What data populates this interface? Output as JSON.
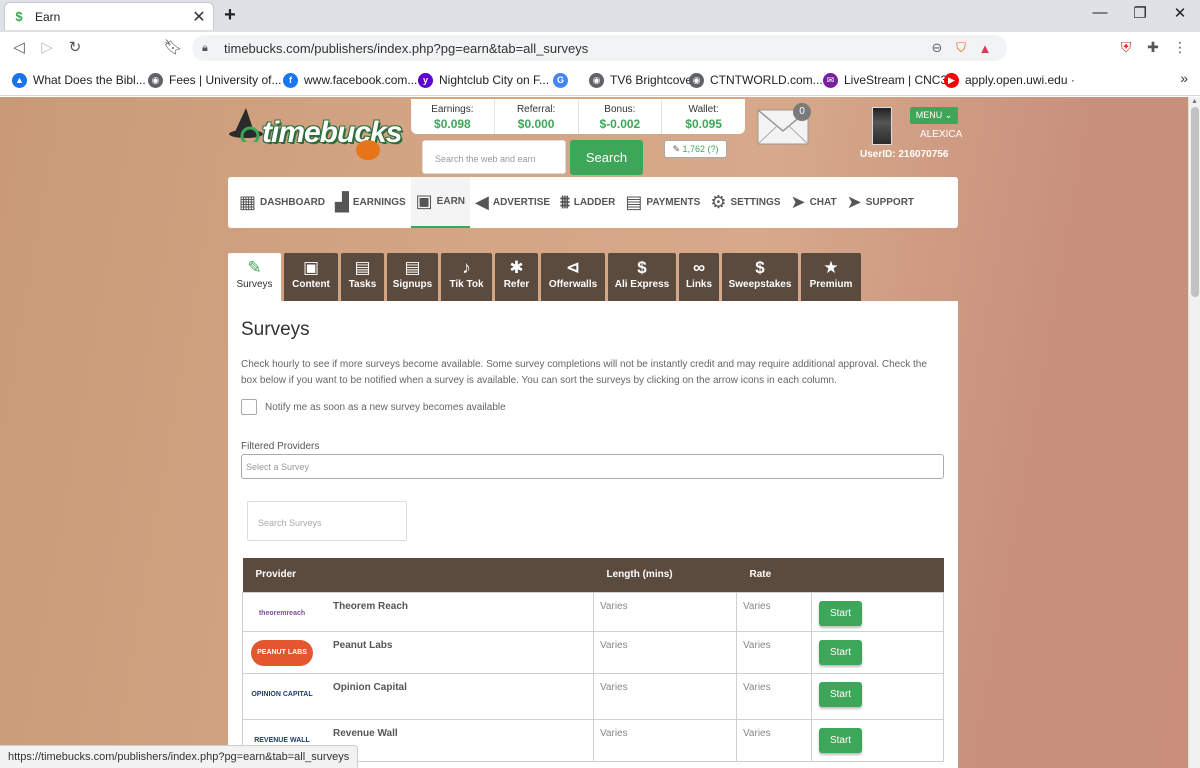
{
  "browser": {
    "tab_title": "Earn",
    "url": "timebucks.com/publishers/index.php?pg=earn&tab=all_surveys",
    "bookmarks": [
      {
        "label": "What Does the Bibl...",
        "color": "#1a73e8",
        "icon": "drive-icon"
      },
      {
        "label": "Fees | University of...",
        "color": "#5f6368",
        "icon": "globe-icon"
      },
      {
        "label": "www.facebook.com...",
        "color": "#1877f2",
        "icon": "facebook-icon"
      },
      {
        "label": "Nightclub City on F...",
        "color": "#6001d2",
        "icon": "yahoo-icon"
      },
      {
        "label": "",
        "color": "#4285f4",
        "icon": "google-icon"
      },
      {
        "label": "TV6 Brightcove",
        "color": "#5f6368",
        "icon": "globe-icon"
      },
      {
        "label": "CTNTWORLD.com...",
        "color": "#5f6368",
        "icon": "globe-icon"
      },
      {
        "label": "LiveStream | CNC3",
        "color": "#7b1fa2",
        "icon": "mail-icon"
      },
      {
        "label": "apply.open.uwi.edu ·",
        "color": "#ff0000",
        "icon": "youtube-icon"
      }
    ],
    "status_url": "https://timebucks.com/publishers/index.php?pg=earn&tab=all_surveys"
  },
  "header": {
    "logo_text": "timebucks",
    "stats": [
      {
        "label": "Earnings:",
        "value": "$0.098"
      },
      {
        "label": "Referral:",
        "value": "$0.000"
      },
      {
        "label": "Bonus:",
        "value": "$-0.002"
      },
      {
        "label": "Wallet:",
        "value": "$0.095"
      }
    ],
    "search_placeholder": "Search the web and earn",
    "search_button": "Search",
    "points": "1,762 (?)",
    "mail_count": "0",
    "menu_label": "MENU",
    "username": "ALEXICA",
    "userid": "UserID: 216070756"
  },
  "mainnav": [
    {
      "label": "Dashboard",
      "icon": "▦"
    },
    {
      "label": "Earnings",
      "icon": "▟"
    },
    {
      "label": "Earn",
      "icon": "▣",
      "active": true
    },
    {
      "label": "Advertise",
      "icon": "◀"
    },
    {
      "label": "Ladder",
      "icon": "⩩"
    },
    {
      "label": "Payments",
      "icon": "▤"
    },
    {
      "label": "Settings",
      "icon": "⚙"
    },
    {
      "label": "Chat",
      "icon": "➤"
    },
    {
      "label": "Support",
      "icon": "➤"
    }
  ],
  "subtabs": [
    {
      "label": "Surveys",
      "icon": "✎",
      "active": true,
      "width": 53
    },
    {
      "label": "Content",
      "icon": "▣",
      "width": 54
    },
    {
      "label": "Tasks",
      "icon": "▤",
      "width": 43
    },
    {
      "label": "Signups",
      "icon": "▤",
      "width": 51
    },
    {
      "label": "Tik Tok",
      "icon": "♪",
      "width": 51
    },
    {
      "label": "Refer",
      "icon": "✱",
      "width": 43
    },
    {
      "label": "Offerwalls",
      "icon": "⊲",
      "width": 64
    },
    {
      "label": "Ali Express",
      "icon": "$",
      "width": 68
    },
    {
      "label": "Links",
      "icon": "∞",
      "width": 40
    },
    {
      "label": "Sweepstakes",
      "icon": "$",
      "width": 76
    },
    {
      "label": "Premium",
      "icon": "★",
      "width": 60
    }
  ],
  "surveys": {
    "title": "Surveys",
    "description": "Check hourly to see if more surveys become available. Some survey completions will not be instantly credit and may require additional approval. Check the box below if you want to be notified when a survey is available. You can sort the surveys by clicking on the arrow icons in each column.",
    "notify_label": "Notify me as soon as a new survey becomes available",
    "filter_label": "Filtered Providers",
    "filter_placeholder": "Select a Survey",
    "search_placeholder": "Search Surveys",
    "columns": [
      "Provider",
      "Length (mins)",
      "Rate",
      ""
    ],
    "rows": [
      {
        "name": "Theorem Reach",
        "logo": "theoremreach",
        "length": "Varies",
        "rate": "Varies",
        "action": "Start"
      },
      {
        "name": "Peanut Labs",
        "logo": "PEANUT LABS",
        "length": "Varies",
        "rate": "Varies",
        "action": "Start"
      },
      {
        "name": "Opinion Capital",
        "logo": "OPINION CAPITAL",
        "length": "Varies",
        "rate": "Varies",
        "action": "Start"
      },
      {
        "name": "Revenue Wall",
        "logo": "REVENUE WALL",
        "length": "Varies",
        "rate": "Varies",
        "action": "Start"
      }
    ]
  }
}
